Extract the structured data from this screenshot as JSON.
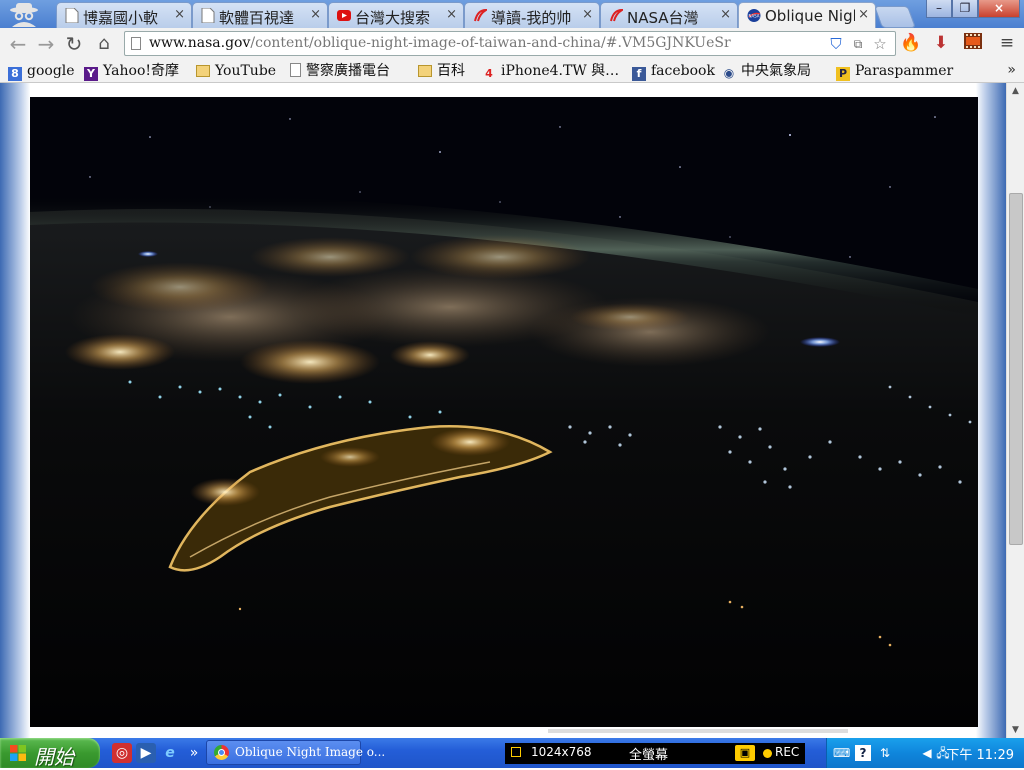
{
  "window": {
    "tabs": [
      {
        "label": "博嘉國小軟",
        "icon": "page-icon"
      },
      {
        "label": "軟體百視達",
        "icon": "page-icon"
      },
      {
        "label": "台灣大搜索",
        "icon": "youtube-icon"
      },
      {
        "label": "導讀-我的帅",
        "icon": "swirl-icon"
      },
      {
        "label": "NASA台灣",
        "icon": "swirl-icon"
      },
      {
        "label": "Oblique Nigh",
        "icon": "nasa-icon",
        "active": true
      }
    ],
    "tab_close_glyph": "×",
    "controls": {
      "minimize": "–",
      "restore": "❐",
      "close": "×"
    }
  },
  "toolbar": {
    "url_host": "www.nasa.gov",
    "url_path": "/content/oblique-night-image-of-taiwan-and-china/#.VM5GJNKUeSr"
  },
  "bookmarks": [
    {
      "label": "google",
      "icon": "google-icon",
      "glyph": "8"
    },
    {
      "label": "Yahoo!奇摩",
      "icon": "yahoo-icon",
      "glyph": "Y"
    },
    {
      "label": "YouTube",
      "icon": "folder-icon",
      "glyph": ""
    },
    {
      "label": "警察廣播電台",
      "icon": "page-icon",
      "glyph": ""
    },
    {
      "label": "百科",
      "icon": "folder-icon",
      "glyph": ""
    },
    {
      "label": "iPhone4.TW 與…",
      "icon": "iphone4tw-icon",
      "glyph": "4"
    },
    {
      "label": "facebook",
      "icon": "facebook-icon",
      "glyph": "f"
    },
    {
      "label": "中央氣象局",
      "icon": "eye-icon",
      "glyph": "👁"
    },
    {
      "label": "Paraspammer",
      "icon": "paraspammer-icon",
      "glyph": "P"
    }
  ],
  "bookmarks_more": "»",
  "content": {
    "image_label": "Oblique Night Image of Taiwan and China"
  },
  "taskbar": {
    "start_label": "開始",
    "task_label": "Oblique Night Image o...",
    "recorder": {
      "resolution": "1024x768",
      "mode": "全螢幕",
      "rec_label": "REC"
    },
    "clock": "下午 11:29"
  },
  "colors": {
    "taskbar": "#245ed8",
    "start": "#3a9a2f",
    "tray": "#0f86dc"
  }
}
